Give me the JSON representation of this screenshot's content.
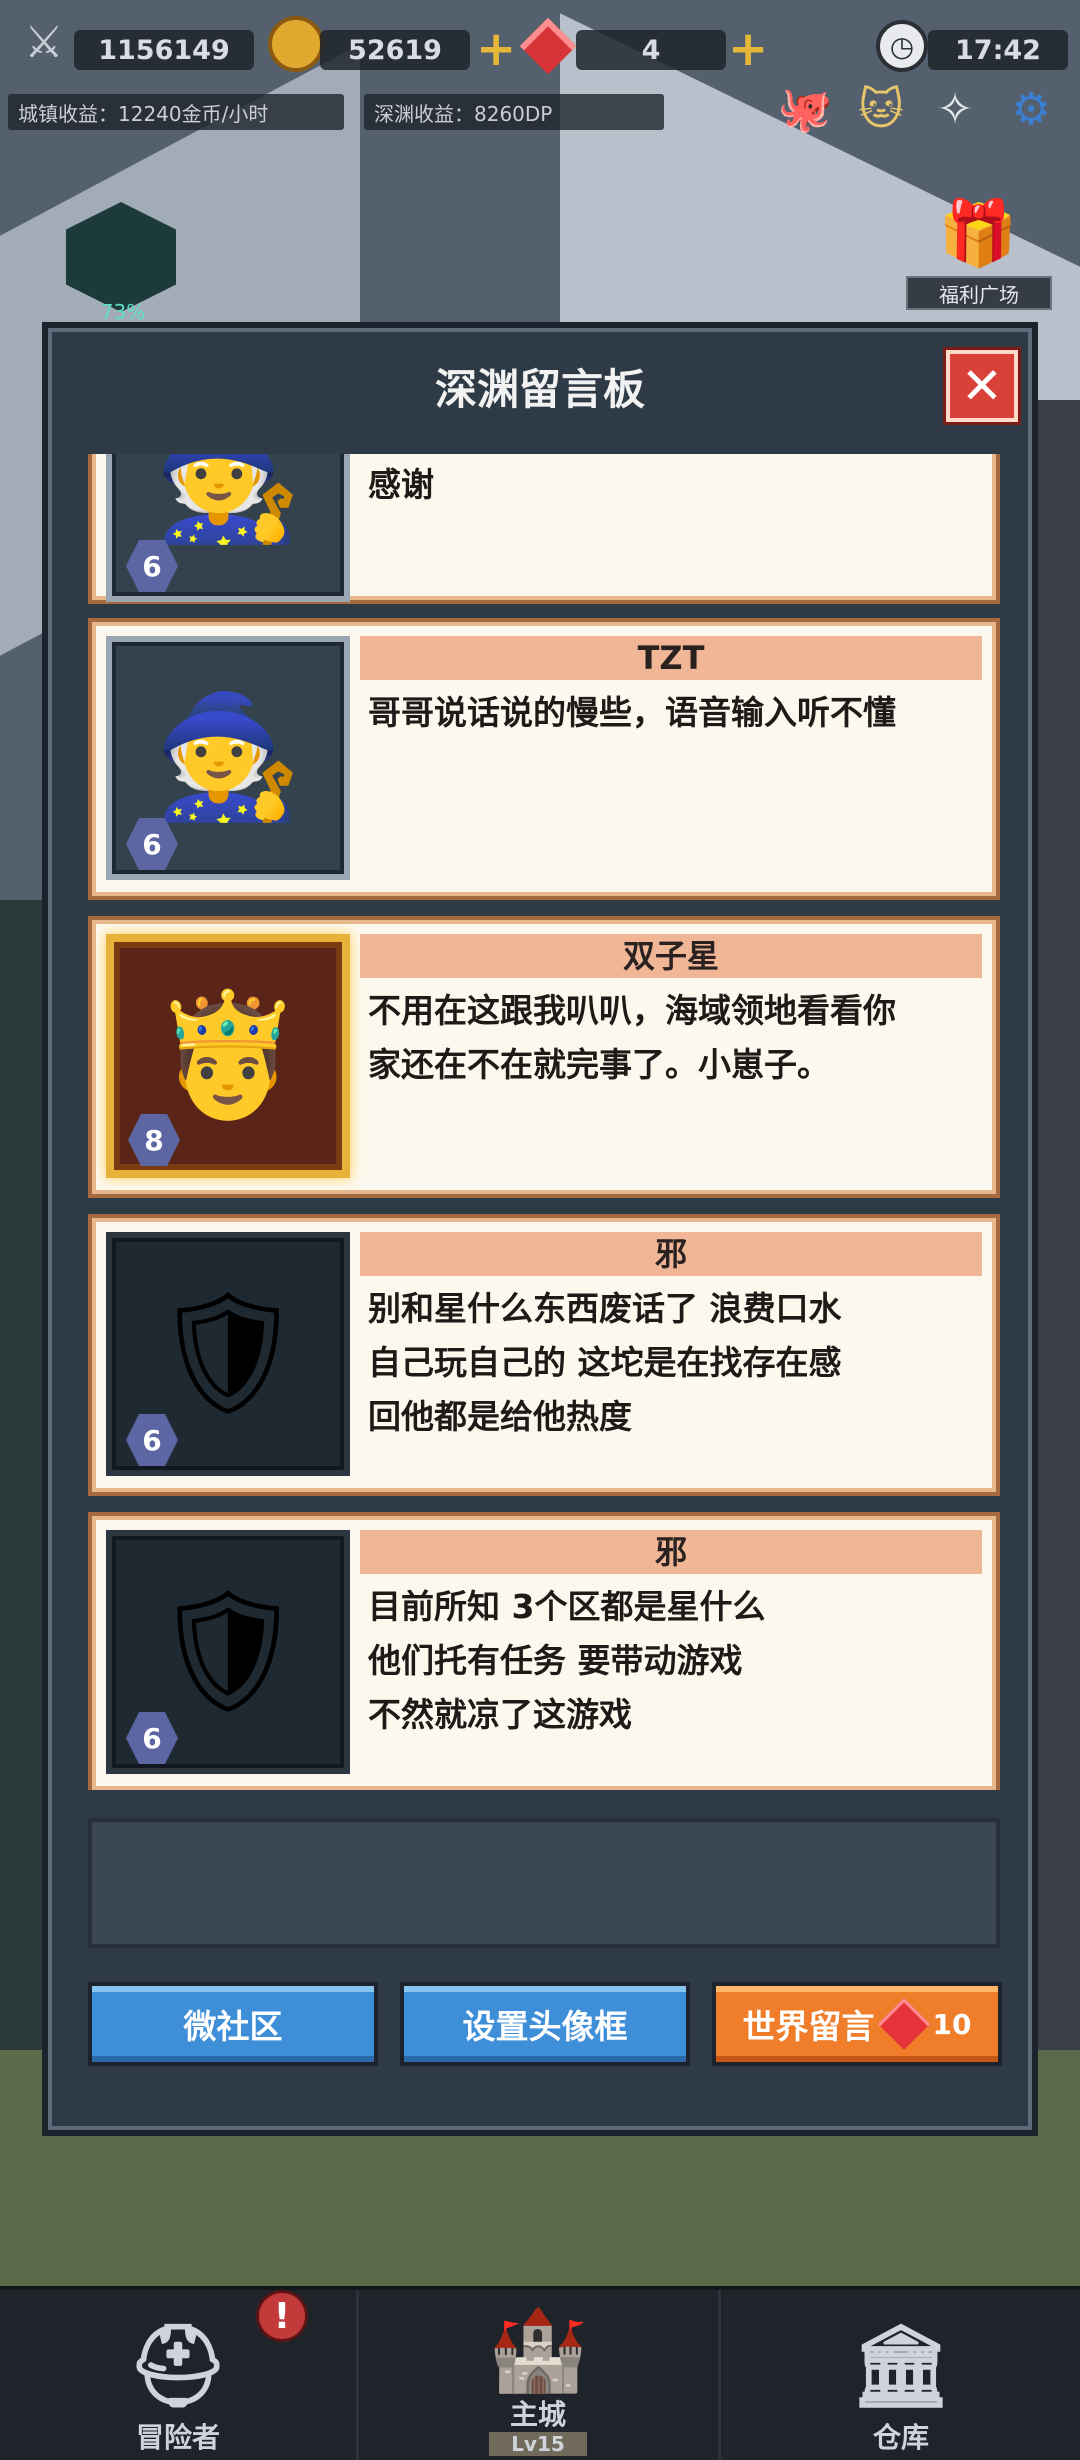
{
  "status_bar": {
    "power": "1156149",
    "gold": "52619",
    "gems": "4",
    "time": "17:42"
  },
  "stats": {
    "town_income": "城镇收益：12240金币/小时",
    "abyss_income": "深渊收益：8260DP"
  },
  "side": {
    "progress": "73%",
    "welfare": "福利广场"
  },
  "dialog": {
    "title": "深渊留言板",
    "messages": [
      {
        "name": "",
        "text": "感谢",
        "level": "6",
        "frame": "normal"
      },
      {
        "name": "TZT",
        "text": "哥哥说话说的慢些，语音输入听不懂",
        "level": "6",
        "frame": "normal"
      },
      {
        "name": "双子星",
        "text": "不用在这跟我叭叭，海域领地看看你\n家还在不在就完事了。小崽子。",
        "level": "8",
        "frame": "gold"
      },
      {
        "name": "邪",
        "text": "别和星什么东西废话了 浪费口水\n自己玩自己的 这坨是在找存在感\n回他都是给他热度",
        "level": "6",
        "frame": "dark"
      },
      {
        "name": "邪",
        "text": "目前所知 3个区都是星什么\n他们托有任务 要带动游戏\n不然就凉了这游戏",
        "level": "6",
        "frame": "dark"
      }
    ],
    "buttons": {
      "community": "微社区",
      "avatar_frame": "设置头像框",
      "world_message": "世界留言",
      "world_message_cost": "10"
    }
  },
  "bottom_nav": {
    "adventurer": "冒险者",
    "main_city": "主城",
    "main_city_level": "Lv15",
    "warehouse": "仓库",
    "alert": "!"
  }
}
